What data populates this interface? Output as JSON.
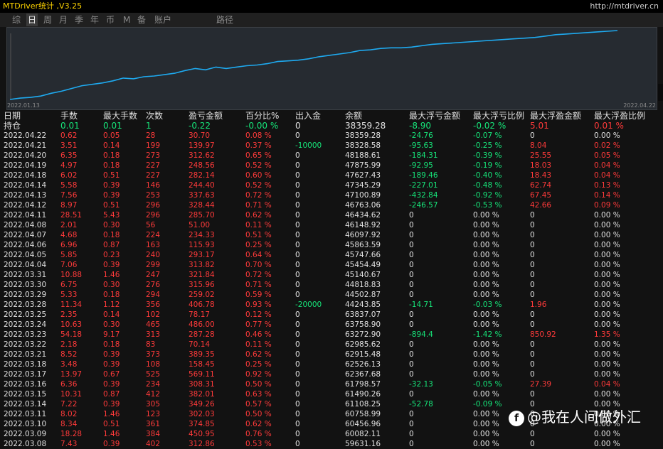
{
  "window": {
    "title": "MTDriver统计 ,V3.25",
    "url": "http://mtdriver.cn"
  },
  "tabs": [
    {
      "label": "综",
      "active": false
    },
    {
      "label": "日",
      "active": true
    },
    {
      "label": "周",
      "active": false
    },
    {
      "label": "月",
      "active": false
    },
    {
      "label": "季",
      "active": false
    },
    {
      "label": "年",
      "active": false
    },
    {
      "label": "币",
      "active": false
    },
    {
      "label": "M",
      "active": false
    },
    {
      "label": "备",
      "active": false
    },
    {
      "label": "账户",
      "active": false
    },
    {
      "label": "路径",
      "active": false
    }
  ],
  "chart_data": {
    "type": "line",
    "x_start_label": "2022.01.13",
    "x_end_label": "2022.04.22",
    "line_color": "#1eaaf0",
    "grid": false,
    "series": [
      {
        "values": [
          0.0,
          0.02,
          0.03,
          0.05,
          0.09,
          0.12,
          0.16,
          0.2,
          0.22,
          0.24,
          0.27,
          0.31,
          0.3,
          0.33,
          0.34,
          0.36,
          0.38,
          0.42,
          0.45,
          0.43,
          0.47,
          0.45,
          0.47,
          0.49,
          0.5,
          0.52,
          0.55,
          0.56,
          0.57,
          0.59,
          0.62,
          0.64,
          0.66,
          0.68,
          0.71,
          0.72,
          0.74,
          0.75,
          0.75,
          0.76,
          0.78,
          0.8,
          0.81,
          0.82,
          0.83,
          0.84,
          0.85,
          0.86,
          0.87,
          0.88,
          0.89,
          0.9,
          0.92,
          0.94,
          0.95,
          0.96,
          0.97,
          0.98,
          0.99,
          1.0
        ]
      }
    ]
  },
  "table": {
    "headers": [
      "日期",
      "手数",
      "最大手数",
      "次数",
      "盈亏金额",
      "百分比%",
      "出入金",
      "余额",
      "最大浮亏金额",
      "最大浮亏比例",
      "最大浮盈金额",
      "最大浮盈比例"
    ],
    "holding": [
      "持仓",
      "0.01",
      "0.01",
      "1",
      "-0.22",
      "-0.00 %",
      "0",
      "38359.28",
      "-8.90",
      "-0.02 %",
      "5.01",
      "0.01 %"
    ],
    "rows": [
      [
        "2022.04.22",
        "0.62",
        "0.05",
        "28",
        "30.70",
        "0.08 %",
        "0",
        "38359.28",
        "-24.76",
        "-0.07 %",
        "0",
        "0.00 %"
      ],
      [
        "2022.04.21",
        "3.51",
        "0.14",
        "199",
        "139.97",
        "0.37 %",
        "-10000",
        "38328.58",
        "-95.63",
        "-0.25 %",
        "8.04",
        "0.02 %"
      ],
      [
        "2022.04.20",
        "6.35",
        "0.18",
        "273",
        "312.62",
        "0.65 %",
        "0",
        "48188.61",
        "-184.31",
        "-0.39 %",
        "25.55",
        "0.05 %"
      ],
      [
        "2022.04.19",
        "4.97",
        "0.18",
        "227",
        "248.56",
        "0.52 %",
        "0",
        "47875.99",
        "-92.95",
        "-0.19 %",
        "18.03",
        "0.04 %"
      ],
      [
        "2022.04.18",
        "6.02",
        "0.51",
        "227",
        "282.14",
        "0.60 %",
        "0",
        "47627.43",
        "-189.46",
        "-0.40 %",
        "18.43",
        "0.04 %"
      ],
      [
        "2022.04.14",
        "5.58",
        "0.39",
        "146",
        "244.40",
        "0.52 %",
        "0",
        "47345.29",
        "-227.01",
        "-0.48 %",
        "62.74",
        "0.13 %"
      ],
      [
        "2022.04.13",
        "7.56",
        "0.39",
        "253",
        "337.63",
        "0.72 %",
        "0",
        "47100.89",
        "-432.84",
        "-0.92 %",
        "67.45",
        "0.14 %"
      ],
      [
        "2022.04.12",
        "8.97",
        "0.51",
        "296",
        "328.44",
        "0.71 %",
        "0",
        "46763.06",
        "-246.57",
        "-0.53 %",
        "42.66",
        "0.09 %"
      ],
      [
        "2022.04.11",
        "28.51",
        "5.43",
        "296",
        "285.70",
        "0.62 %",
        "0",
        "46434.62",
        "0",
        "0.00 %",
        "0",
        "0.00 %"
      ],
      [
        "2022.04.08",
        "2.01",
        "0.30",
        "56",
        "51.00",
        "0.11 %",
        "0",
        "46148.92",
        "0",
        "0.00 %",
        "0",
        "0.00 %"
      ],
      [
        "2022.04.07",
        "4.68",
        "0.18",
        "224",
        "234.33",
        "0.51 %",
        "0",
        "46097.92",
        "0",
        "0.00 %",
        "0",
        "0.00 %"
      ],
      [
        "2022.04.06",
        "6.96",
        "0.87",
        "163",
        "115.93",
        "0.25 %",
        "0",
        "45863.59",
        "0",
        "0.00 %",
        "0",
        "0.00 %"
      ],
      [
        "2022.04.05",
        "5.85",
        "0.23",
        "240",
        "293.17",
        "0.64 %",
        "0",
        "45747.66",
        "0",
        "0.00 %",
        "0",
        "0.00 %"
      ],
      [
        "2022.04.04",
        "7.06",
        "0.39",
        "299",
        "313.82",
        "0.70 %",
        "0",
        "45454.49",
        "0",
        "0.00 %",
        "0",
        "0.00 %"
      ],
      [
        "2022.03.31",
        "10.88",
        "1.46",
        "247",
        "321.84",
        "0.72 %",
        "0",
        "45140.67",
        "0",
        "0.00 %",
        "0",
        "0.00 %"
      ],
      [
        "2022.03.30",
        "6.75",
        "0.30",
        "276",
        "315.96",
        "0.71 %",
        "0",
        "44818.83",
        "0",
        "0.00 %",
        "0",
        "0.00 %"
      ],
      [
        "2022.03.29",
        "5.33",
        "0.18",
        "294",
        "259.02",
        "0.59 %",
        "0",
        "44502.87",
        "0",
        "0.00 %",
        "0",
        "0.00 %"
      ],
      [
        "2022.03.28",
        "11.34",
        "1.12",
        "356",
        "406.78",
        "0.93 %",
        "-20000",
        "44243.85",
        "-14.71",
        "-0.03 %",
        "1.96",
        "0.00 %"
      ],
      [
        "2022.03.25",
        "2.35",
        "0.14",
        "102",
        "78.17",
        "0.12 %",
        "0",
        "63837.07",
        "0",
        "0.00 %",
        "0",
        "0.00 %"
      ],
      [
        "2022.03.24",
        "10.63",
        "0.30",
        "465",
        "486.00",
        "0.77 %",
        "0",
        "63758.90",
        "0",
        "0.00 %",
        "0",
        "0.00 %"
      ],
      [
        "2022.03.23",
        "54.18",
        "9.17",
        "313",
        "287.28",
        "0.46 %",
        "0",
        "63272.90",
        "-894.4",
        "-1.42 %",
        "850.92",
        "1.35 %"
      ],
      [
        "2022.03.22",
        "2.18",
        "0.18",
        "83",
        "70.14",
        "0.11 %",
        "0",
        "62985.62",
        "0",
        "0.00 %",
        "0",
        "0.00 %"
      ],
      [
        "2022.03.21",
        "8.52",
        "0.39",
        "373",
        "389.35",
        "0.62 %",
        "0",
        "62915.48",
        "0",
        "0.00 %",
        "0",
        "0.00 %"
      ],
      [
        "2022.03.18",
        "3.48",
        "0.39",
        "108",
        "158.45",
        "0.25 %",
        "0",
        "62526.13",
        "0",
        "0.00 %",
        "0",
        "0.00 %"
      ],
      [
        "2022.03.17",
        "13.97",
        "0.67",
        "525",
        "569.11",
        "0.92 %",
        "0",
        "62367.68",
        "0",
        "0.00 %",
        "0",
        "0.00 %"
      ],
      [
        "2022.03.16",
        "6.36",
        "0.39",
        "234",
        "308.31",
        "0.50 %",
        "0",
        "61798.57",
        "-32.13",
        "-0.05 %",
        "27.39",
        "0.04 %"
      ],
      [
        "2022.03.15",
        "10.31",
        "0.87",
        "412",
        "382.01",
        "0.63 %",
        "0",
        "61490.26",
        "0",
        "0.00 %",
        "0",
        "0.00 %"
      ],
      [
        "2022.03.14",
        "7.22",
        "0.39",
        "305",
        "349.26",
        "0.57 %",
        "0",
        "61108.25",
        "-52.78",
        "-0.09 %",
        "0",
        "0.00 %"
      ],
      [
        "2022.03.11",
        "8.02",
        "1.46",
        "123",
        "302.03",
        "0.50 %",
        "0",
        "60758.99",
        "0",
        "0.00 %",
        "0",
        "0.00 %"
      ],
      [
        "2022.03.10",
        "8.34",
        "0.51",
        "361",
        "374.85",
        "0.62 %",
        "0",
        "60456.96",
        "0",
        "0.00 %",
        "0",
        "0.00 %"
      ],
      [
        "2022.03.09",
        "18.28",
        "1.46",
        "384",
        "450.95",
        "0.76 %",
        "0",
        "60082.11",
        "0",
        "0.00 %",
        "0",
        "0.00 %"
      ],
      [
        "2022.03.08",
        "7.43",
        "0.39",
        "402",
        "312.86",
        "0.53 %",
        "0",
        "59631.16",
        "0",
        "0.00 %",
        "0",
        "0.00 %"
      ]
    ]
  },
  "watermark": {
    "logo": "f",
    "text": "@我在人间做外汇"
  }
}
